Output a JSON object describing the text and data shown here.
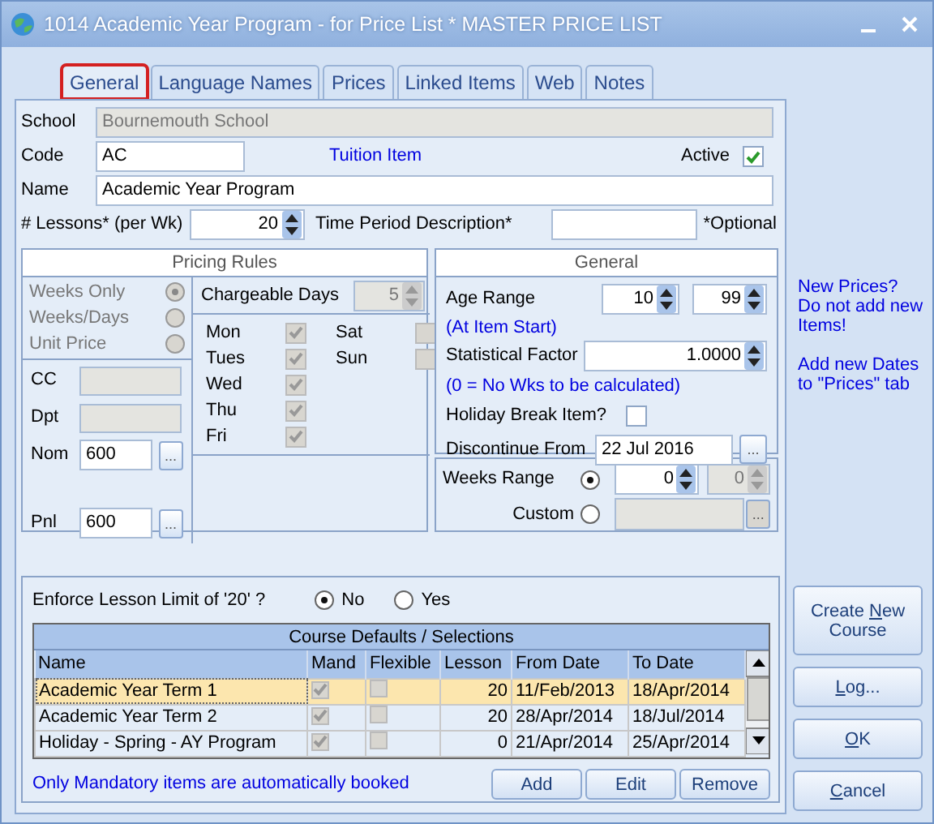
{
  "window": {
    "title": "1014 Academic Year Program - for Price List * MASTER PRICE LIST"
  },
  "tabs": [
    {
      "label": "General",
      "selected": true
    },
    {
      "label": "Language Names",
      "selected": false
    },
    {
      "label": "Prices",
      "selected": false
    },
    {
      "label": "Linked Items",
      "selected": false
    },
    {
      "label": "Web",
      "selected": false
    },
    {
      "label": "Notes",
      "selected": false
    }
  ],
  "school": {
    "label": "School",
    "value": "Bournemouth School",
    "disabled": true
  },
  "code": {
    "label": "Code",
    "value": "AC"
  },
  "item_type": "Tuition Item",
  "active": {
    "label": "Active",
    "checked": true
  },
  "name": {
    "label": "Name",
    "value": "Academic Year Program"
  },
  "lessons": {
    "label": "# Lessons* (per Wk)",
    "value": "20"
  },
  "time_period": {
    "label": "Time Period Description*",
    "note": "*Optional"
  },
  "pricing_rules": {
    "title": "Pricing Rules",
    "disabled": true,
    "modes": [
      {
        "label": "Weeks Only",
        "selected": true
      },
      {
        "label": "Weeks/Days",
        "selected": false
      },
      {
        "label": "Unit Price",
        "selected": false
      }
    ],
    "chargeable_days": {
      "label": "Chargeable Days",
      "value": "5"
    },
    "days": [
      {
        "label": "Mon",
        "checked": true
      },
      {
        "label": "Tues",
        "checked": true
      },
      {
        "label": "Wed",
        "checked": true
      },
      {
        "label": "Thu",
        "checked": true
      },
      {
        "label": "Fri",
        "checked": true
      },
      {
        "label": "Sat",
        "checked": false
      },
      {
        "label": "Sun",
        "checked": false
      }
    ],
    "accounts": [
      {
        "label": "CC",
        "kind": "plain"
      },
      {
        "label": "Dpt",
        "kind": "plain"
      },
      {
        "label": "Nom",
        "kind": "lookup",
        "value": "600",
        "button": "..."
      },
      {
        "label": "Pnl",
        "kind": "lookup",
        "value": "600",
        "button": "..."
      }
    ]
  },
  "general": {
    "title": "General",
    "age_range": {
      "label": "Age Range",
      "from": "10",
      "to": "99",
      "note": "(At Item Start)"
    },
    "statistical_factor": {
      "label": "Statistical Factor",
      "value": "1.0000",
      "note": "(0 = No  Wks to be calculated)"
    },
    "holiday_break": {
      "label": "Holiday Break Item?",
      "checked": false
    },
    "discontinue_from": {
      "label": "Discontinue From",
      "value": "22 Jul 2016",
      "button": "..."
    }
  },
  "duration": [
    {
      "kind": "range",
      "label": "Weeks Range",
      "selected": true,
      "from": "0",
      "to": "0",
      "to_disabled": true
    },
    {
      "kind": "custom",
      "label": "Custom",
      "selected": false,
      "disabled": true,
      "button": "..."
    }
  ],
  "side_notes": [
    "New Prices? Do not add new Items!",
    "Add new Dates to \"Prices\" tab"
  ],
  "enforce": {
    "label": "Enforce Lesson Limit of '20' ?",
    "options": [
      {
        "label": "No",
        "selected": true
      },
      {
        "label": "Yes",
        "selected": false
      }
    ]
  },
  "course_table": {
    "title": "Course Defaults / Selections",
    "columns": [
      "Name",
      "Mand",
      "Flexible",
      "Lesson",
      "From Date",
      "To Date"
    ],
    "rows": [
      {
        "name": "Academic Year Term 1",
        "mand": true,
        "flexible": false,
        "lesson": "20",
        "from": "11/Feb/2013",
        "to": "18/Apr/2014",
        "selected": true
      },
      {
        "name": "Academic Year Term 2",
        "mand": true,
        "flexible": false,
        "lesson": "20",
        "from": "28/Apr/2014",
        "to": "18/Jul/2014",
        "selected": false
      },
      {
        "name": "Holiday - Spring - AY Program",
        "mand": true,
        "flexible": false,
        "lesson": "0",
        "from": "21/Apr/2014",
        "to": "25/Apr/2014",
        "selected": false
      }
    ]
  },
  "footer_note": "Only Mandatory items are automatically booked",
  "table_buttons": [
    "Add",
    "Edit",
    "Remove"
  ],
  "side_buttons": [
    {
      "before": "Create ",
      "key": "N",
      "after": "ew Course"
    },
    {
      "key": "L",
      "after": "og..."
    },
    {
      "key": "O",
      "after": "K"
    },
    {
      "key": "C",
      "after": "ancel"
    }
  ]
}
